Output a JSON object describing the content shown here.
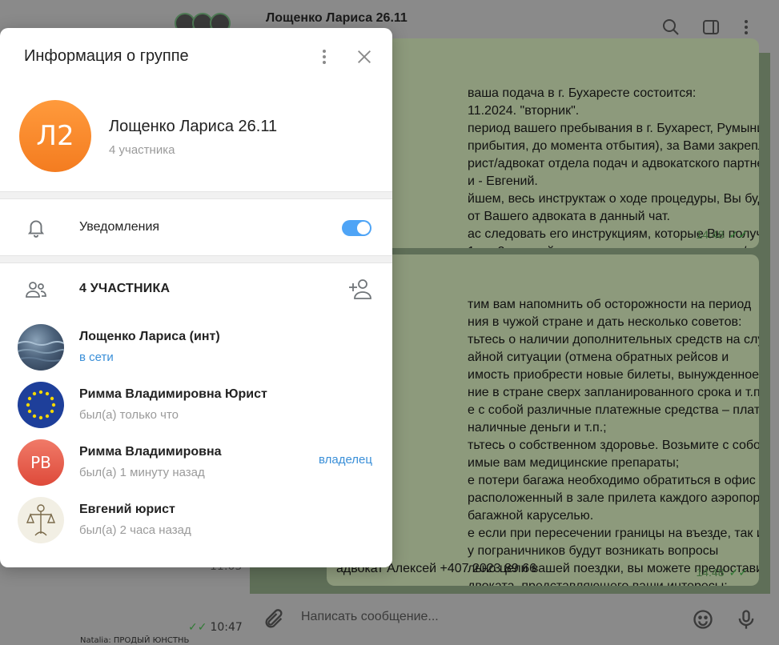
{
  "background": {
    "chat_title": "Лощенко Лариса 26.11",
    "left_time_1": "11:05",
    "left_time_2": "10:47",
    "left_bottom_text": "Natalia: ПРОДЫЙ ЮНСТНЬ",
    "bubble1_lines": "ваша подача в г. Бухаресте состоится:\n11.2024. \"вторник\".\nпериод вашего пребывания в г. Бухарест, Румыния (с\nприбытия, до момента отбытия), за Вами закрепляется\nрист/адвокат отдела подач и адвокатского партнерства\nи - Евгений.\nйшем, весь инструктаж о ходе процедуры, Вы будете\nот Вашего адвоката в данный чат.\nас следовать его инструкциям, которые Вы получите, в\n1-го, 2-ух дней и в случае наличия вопросов и/или\nий, озвучивать их в данный чат.",
    "bubble1_time": "14:48",
    "bubble2_lines": "тим вам напомнить об осторожности на период\nния в чужой стране и дать несколько советов:\nтьтесь о наличии дополнительных средств на случай\nайной ситуации (отмена обратных рейсов и\nимость приобрести новые билеты, вынужденное\nние в стране сверх запланированного срока и т.п.).\nе с собой различные платежные средства – платежные\nналичные деньги и т.п.;\nтьтесь о собственном здоровье. Возьмите с собой\nимые вам медицинские препараты;\nе потери багажа необходимо обратиться в офис LOST &\nрасположенный в зале прилета каждого аэропорта\nбагажной каруселью.\nе если при пересечении границы на въезде, так и на\nу пограничников будут возникать вопросы\nльно цели вашей поездки, вы можете предоставить\nдвоката, представляющего ваши интересы:",
    "bubble2_last_line": "адвокат Алексей +407 2023 89 66",
    "bubble2_time": "14:48",
    "composer_placeholder": "Написать сообщение..."
  },
  "modal": {
    "title": "Информация о группе",
    "group": {
      "avatar_initials": "Л2",
      "avatar_color": "#f47c20",
      "name": "Лощенко Лариса 26.11",
      "members_count": "4 участника"
    },
    "notifications": {
      "label": "Уведомления",
      "enabled": true
    },
    "members_header": "4 УЧАСТНИКА",
    "members": [
      {
        "name": "Лощенко Лариса (инт)",
        "status": "в сети",
        "role": ""
      },
      {
        "name": "Римма Владимировна Юрист",
        "status": "был(а) только что",
        "role": ""
      },
      {
        "name": "Римма Владимировна",
        "status": "был(а) 1 минуту назад",
        "role": "владелец",
        "initials": "РВ"
      },
      {
        "name": "Евгений юрист",
        "status": "был(а) 2 часа назад",
        "role": ""
      }
    ]
  },
  "colors": {
    "accent": "#3a8fd8",
    "toggle_on": "#4ea4f6",
    "avatar_rv": "#de4a3a"
  }
}
